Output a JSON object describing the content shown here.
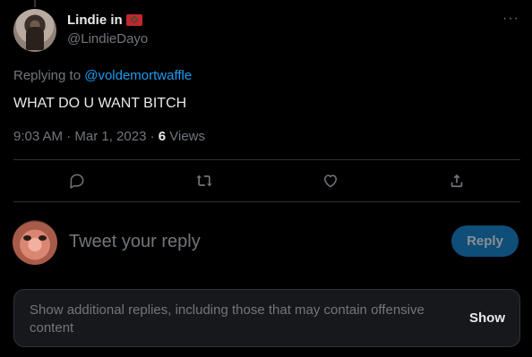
{
  "tweet": {
    "display_name": "Lindie in",
    "handle": "@LindieDayo",
    "more_label": "···",
    "replying_prefix": "Replying to ",
    "replying_mention": "@voldemortwaffle",
    "text": "WHAT DO U WANT BITCH",
    "time": "9:03 AM · Mar 1, 2023 · ",
    "views_count": "6",
    "views_label": " Views"
  },
  "actions": [
    {
      "name": "reply-icon"
    },
    {
      "name": "retweet-icon"
    },
    {
      "name": "like-icon"
    },
    {
      "name": "share-icon"
    }
  ],
  "compose": {
    "placeholder": "Tweet your reply",
    "button_label": "Reply"
  },
  "more_replies": {
    "text": "Show additional replies, including those that may contain offensive content",
    "button_label": "Show"
  },
  "colors": {
    "background": "#000000",
    "text": "#e7e9ea",
    "muted": "#71767b",
    "link": "#1d9bf0",
    "reply_button_disabled": "#0f4e78"
  }
}
